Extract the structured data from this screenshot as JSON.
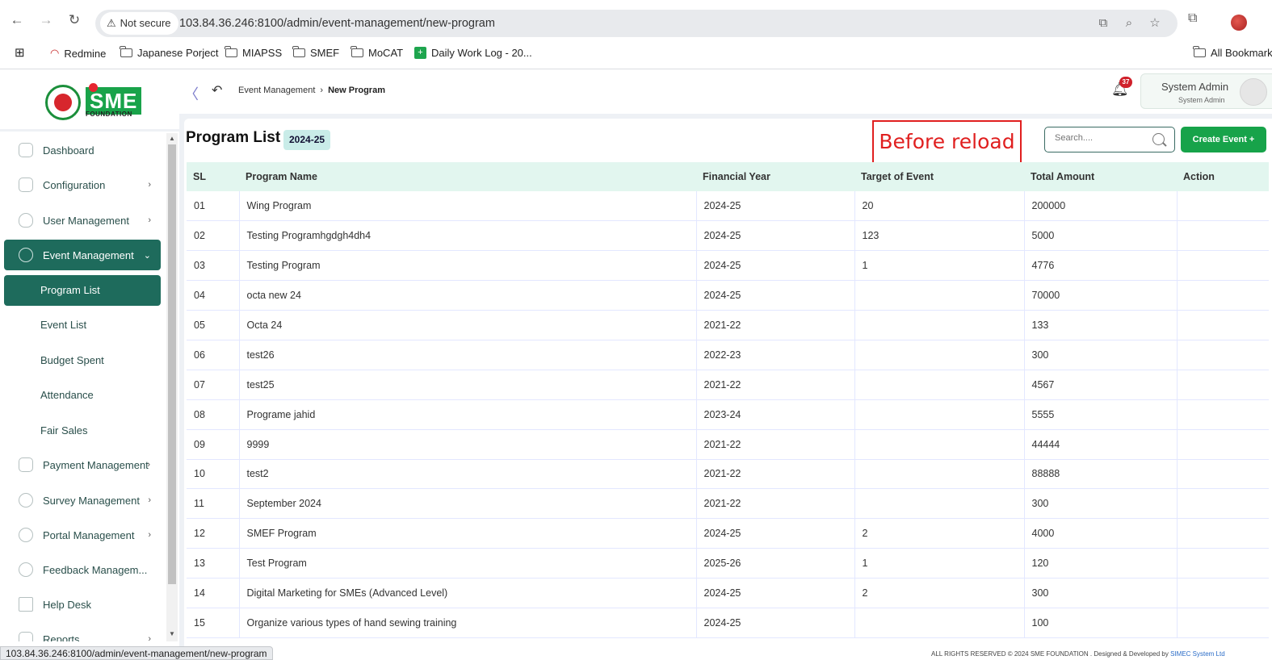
{
  "browser": {
    "security_label": "Not secure",
    "url": "103.84.36.246:8100/admin/event-management/new-program",
    "bookmarks": [
      "Redmine",
      "Japanese Porject",
      "MIAPSS",
      "SMEF",
      "MoCAT",
      "Daily Work Log - 20..."
    ],
    "all_bookmarks": "All Bookmarks"
  },
  "logo": {
    "brand": "SME",
    "sub": "FOUNDATION"
  },
  "sidebar": {
    "items": [
      {
        "label": "Dashboard",
        "chevron": ""
      },
      {
        "label": "Configuration",
        "chevron": "›"
      },
      {
        "label": "User Management",
        "chevron": "›"
      },
      {
        "label": "Event Management",
        "chevron": "⌄"
      },
      {
        "label": "Payment Management",
        "chevron": "›"
      },
      {
        "label": "Survey Management",
        "chevron": "›"
      },
      {
        "label": "Portal Management",
        "chevron": "›"
      },
      {
        "label": "Feedback Managem...",
        "chevron": ""
      },
      {
        "label": "Help Desk",
        "chevron": ""
      },
      {
        "label": "Reports",
        "chevron": "›"
      }
    ],
    "sub_items": [
      "Program List",
      "Event List",
      "Budget Spent",
      "Attendance",
      "Fair Sales"
    ]
  },
  "header": {
    "breadcrumb_parent": "Event Management",
    "breadcrumb_current": "New Program",
    "notification_count": "37",
    "user_name": "System Admin",
    "user_role": "System Admin"
  },
  "main": {
    "title": "Program List",
    "fiscal_badge": "2024-25",
    "annotation": "Before reload",
    "search_placeholder": "Search....",
    "create_button": "Create Event +"
  },
  "table": {
    "headers": [
      "SL",
      "Program Name",
      "Financial Year",
      "Target of Event",
      "Total Amount",
      "Action"
    ],
    "rows": [
      [
        "01",
        "Wing Program",
        "2024-25",
        "20",
        "200000",
        ""
      ],
      [
        "02",
        "Testing Programhgdgh4dh4",
        "2024-25",
        "123",
        "5000",
        ""
      ],
      [
        "03",
        "Testing Program",
        "2024-25",
        "1",
        "4776",
        ""
      ],
      [
        "04",
        "octa new 24",
        "2024-25",
        "",
        "70000",
        ""
      ],
      [
        "05",
        "Octa 24",
        "2021-22",
        "",
        "133",
        ""
      ],
      [
        "06",
        "test26",
        "2022-23",
        "",
        "300",
        ""
      ],
      [
        "07",
        "test25",
        "2021-22",
        "",
        "4567",
        ""
      ],
      [
        "08",
        "Programe jahid",
        "2023-24",
        "",
        "5555",
        ""
      ],
      [
        "09",
        "9999",
        "2021-22",
        "",
        "44444",
        ""
      ],
      [
        "10",
        "test2",
        "2021-22",
        "",
        "88888",
        ""
      ],
      [
        "11",
        "September 2024",
        "2021-22",
        "",
        "300",
        ""
      ],
      [
        "12",
        "SMEF Program",
        "2024-25",
        "2",
        "4000",
        ""
      ],
      [
        "13",
        "Test Program",
        "2025-26",
        "1",
        "120",
        ""
      ],
      [
        "14",
        "Digital Marketing for SMEs (Advanced Level)",
        "2024-25",
        "2",
        "300",
        ""
      ],
      [
        "15",
        "Organize various types of hand sewing training",
        "2024-25",
        "",
        "100",
        ""
      ]
    ]
  },
  "status": {
    "hover_url": "103.84.36.246:8100/admin/event-management/new-program",
    "footer_text": "ALL RIGHTS RESERVED © 2024 SME FOUNDATION . Designed & Developed by",
    "footer_link": "SIMEC System Ltd"
  },
  "colors": {
    "primary": "#1e6b5c",
    "create_button": "#17a34a",
    "annotation_red": "#e01f1f",
    "table_header": "#e2f6ef"
  }
}
